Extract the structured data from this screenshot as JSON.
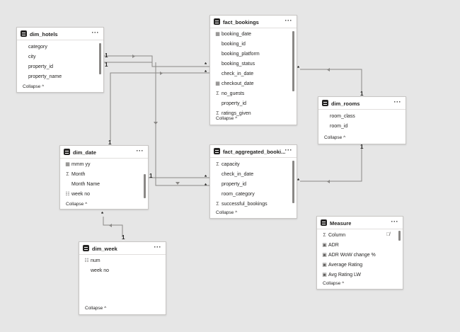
{
  "tables": {
    "dim_hotels": {
      "title": "dim_hotels",
      "more": "···",
      "collapse": "Collapse ^",
      "fields": [
        {
          "icon": "none",
          "label": "category"
        },
        {
          "icon": "none",
          "label": "city"
        },
        {
          "icon": "none",
          "label": "property_id"
        },
        {
          "icon": "none",
          "label": "property_name"
        }
      ]
    },
    "fact_bookings": {
      "title": "fact_bookings",
      "more": "···",
      "collapse": "Collapse ^",
      "fields": [
        {
          "icon": "calendar",
          "label": "booking_date"
        },
        {
          "icon": "none",
          "label": "booking_id"
        },
        {
          "icon": "none",
          "label": "booking_platform"
        },
        {
          "icon": "none",
          "label": "booking_status"
        },
        {
          "icon": "none",
          "label": "check_in_date"
        },
        {
          "icon": "calendar",
          "label": "checkout_date"
        },
        {
          "icon": "sigma",
          "label": "no_guests"
        },
        {
          "icon": "none",
          "label": "property_id"
        },
        {
          "icon": "sigma",
          "label": "ratings_given"
        }
      ]
    },
    "dim_rooms": {
      "title": "dim_rooms",
      "more": "···",
      "collapse": "Collapse ^",
      "fields": [
        {
          "icon": "none",
          "label": "room_class"
        },
        {
          "icon": "none",
          "label": "room_id"
        }
      ]
    },
    "dim_date": {
      "title": "dim_date",
      "more": "···",
      "collapse": "Collapse ^",
      "fields": [
        {
          "icon": "calendar",
          "label": "mmm yy"
        },
        {
          "icon": "sigma",
          "label": "Month"
        },
        {
          "icon": "none",
          "label": "Month Name"
        },
        {
          "icon": "hierarchy",
          "label": "week no"
        }
      ]
    },
    "fact_aggregated": {
      "title": "fact_aggregated_booki...",
      "more": "···",
      "collapse": "Collapse ^",
      "fields": [
        {
          "icon": "sigma",
          "label": "capacity"
        },
        {
          "icon": "none",
          "label": "check_in_date"
        },
        {
          "icon": "none",
          "label": "property_id"
        },
        {
          "icon": "none",
          "label": "room_category"
        },
        {
          "icon": "sigma",
          "label": "successful_bookings"
        }
      ]
    },
    "dim_week": {
      "title": "dim_week",
      "more": "···",
      "collapse": "Collapse ^",
      "fields": [
        {
          "icon": "hierarchy",
          "label": "num"
        },
        {
          "icon": "none",
          "label": "week no"
        }
      ]
    },
    "measure": {
      "title": "Measure",
      "more": "···",
      "collapse": "Collapse ^",
      "hidden_icon": "eye-slash-icon",
      "fields": [
        {
          "icon": "sigma",
          "label": "Column"
        },
        {
          "icon": "calc",
          "label": "ADR"
        },
        {
          "icon": "calc",
          "label": "ADR WoW change %"
        },
        {
          "icon": "calc",
          "label": "Average Rating"
        },
        {
          "icon": "calc",
          "label": "Avg Rating LW"
        }
      ]
    }
  },
  "cardinality": {
    "one": "1",
    "many": "*"
  },
  "colors": {
    "line": "#8a8886",
    "background": "#e6e6e6",
    "card_border": "#c8c6c4"
  }
}
